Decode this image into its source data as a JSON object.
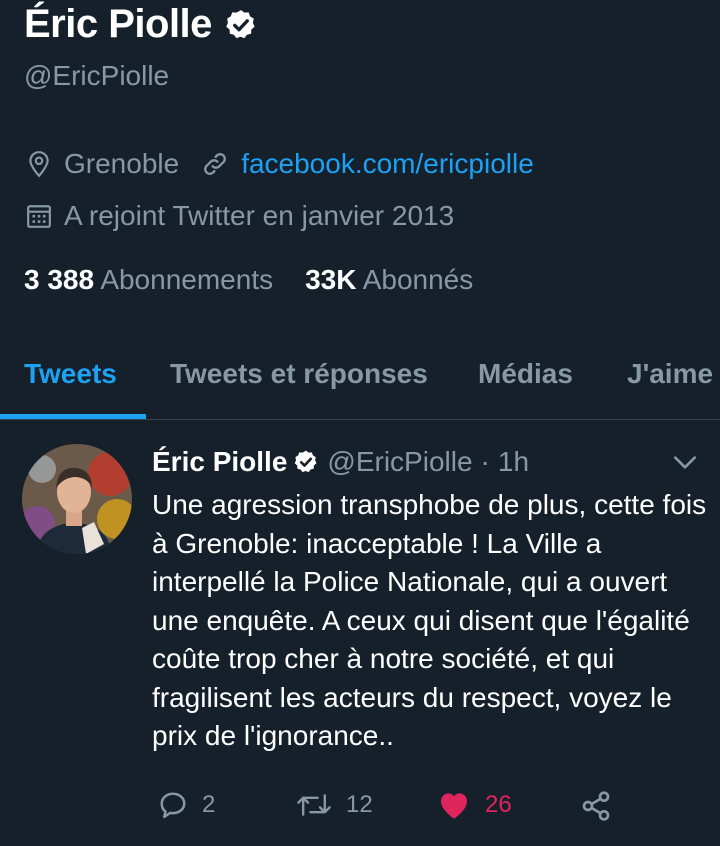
{
  "profile": {
    "name": "Éric Piolle",
    "handle": "@EricPiolle",
    "location": "Grenoble",
    "website": "facebook.com/ericpiolle",
    "joined": "A rejoint Twitter en janvier 2013",
    "following_count": "3 388",
    "following_label": "Abonnements",
    "followers_count": "33K",
    "followers_label": "Abonnés"
  },
  "tabs": [
    {
      "label": "Tweets",
      "active": true
    },
    {
      "label": "Tweets et réponses",
      "active": false
    },
    {
      "label": "Médias",
      "active": false
    },
    {
      "label": "J'aime",
      "active": false
    }
  ],
  "tweet": {
    "author_name": "Éric Piolle",
    "author_handle": "@EricPiolle",
    "separator": "·",
    "time": "1h",
    "text": "Une agression transphobe de plus, cette fois à Grenoble: inacceptable ! La Ville a interpellé la Police Nationale, qui a ouvert une enquête. A ceux qui disent que l'égalité coûte trop cher à notre société, et qui fragilisent les acteurs du respect, voyez le prix de l'ignorance..",
    "replies": "2",
    "retweets": "12",
    "likes": "26",
    "liked": true
  },
  "colors": {
    "background": "#15202b",
    "accent": "#1da1f2",
    "muted": "#8899a6",
    "like": "#e0245e"
  },
  "icons": [
    "verified-badge-icon",
    "location-pin-icon",
    "link-icon",
    "calendar-icon",
    "chevron-down-icon",
    "reply-icon",
    "retweet-icon",
    "heart-icon",
    "share-icon"
  ]
}
